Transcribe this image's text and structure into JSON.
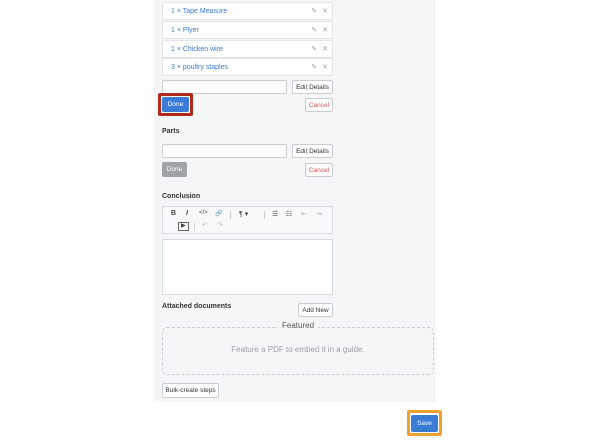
{
  "tools_list": {
    "items": [
      {
        "label": "1 × Tape Measure"
      },
      {
        "label": "1 × Plyer"
      },
      {
        "label": "1 × Chicken wire"
      },
      {
        "label": "3 × poultry staples"
      }
    ],
    "edit_details_label": "Edit Details",
    "done_label": "Done",
    "cancel_label": "Cancel"
  },
  "parts": {
    "heading": "Parts",
    "edit_details_label": "Edit Details",
    "done_label": "Done",
    "cancel_label": "Cancel"
  },
  "conclusion": {
    "heading": "Conclusion",
    "toolbar": {
      "bold": "B",
      "italic": "I",
      "code": "</>",
      "link": "🔗",
      "paragraph": "¶ ▾",
      "bullet_list": "☰",
      "numbered_list": "☷",
      "outdent": "⇤",
      "indent": "⇥",
      "video": "▶",
      "undo": "↶",
      "redo": "↷"
    }
  },
  "attachments": {
    "heading": "Attached documents",
    "add_new_label": "Add New",
    "featured_title": "Featured",
    "featured_text": "Feature a PDF to embed it in a guide."
  },
  "bulk_create_label": "Bulk-create steps",
  "save_label": "Save",
  "colors": {
    "accent": "#3a7bd5",
    "highlight_red": "#b02a1a",
    "highlight_orange": "#f0a030"
  }
}
